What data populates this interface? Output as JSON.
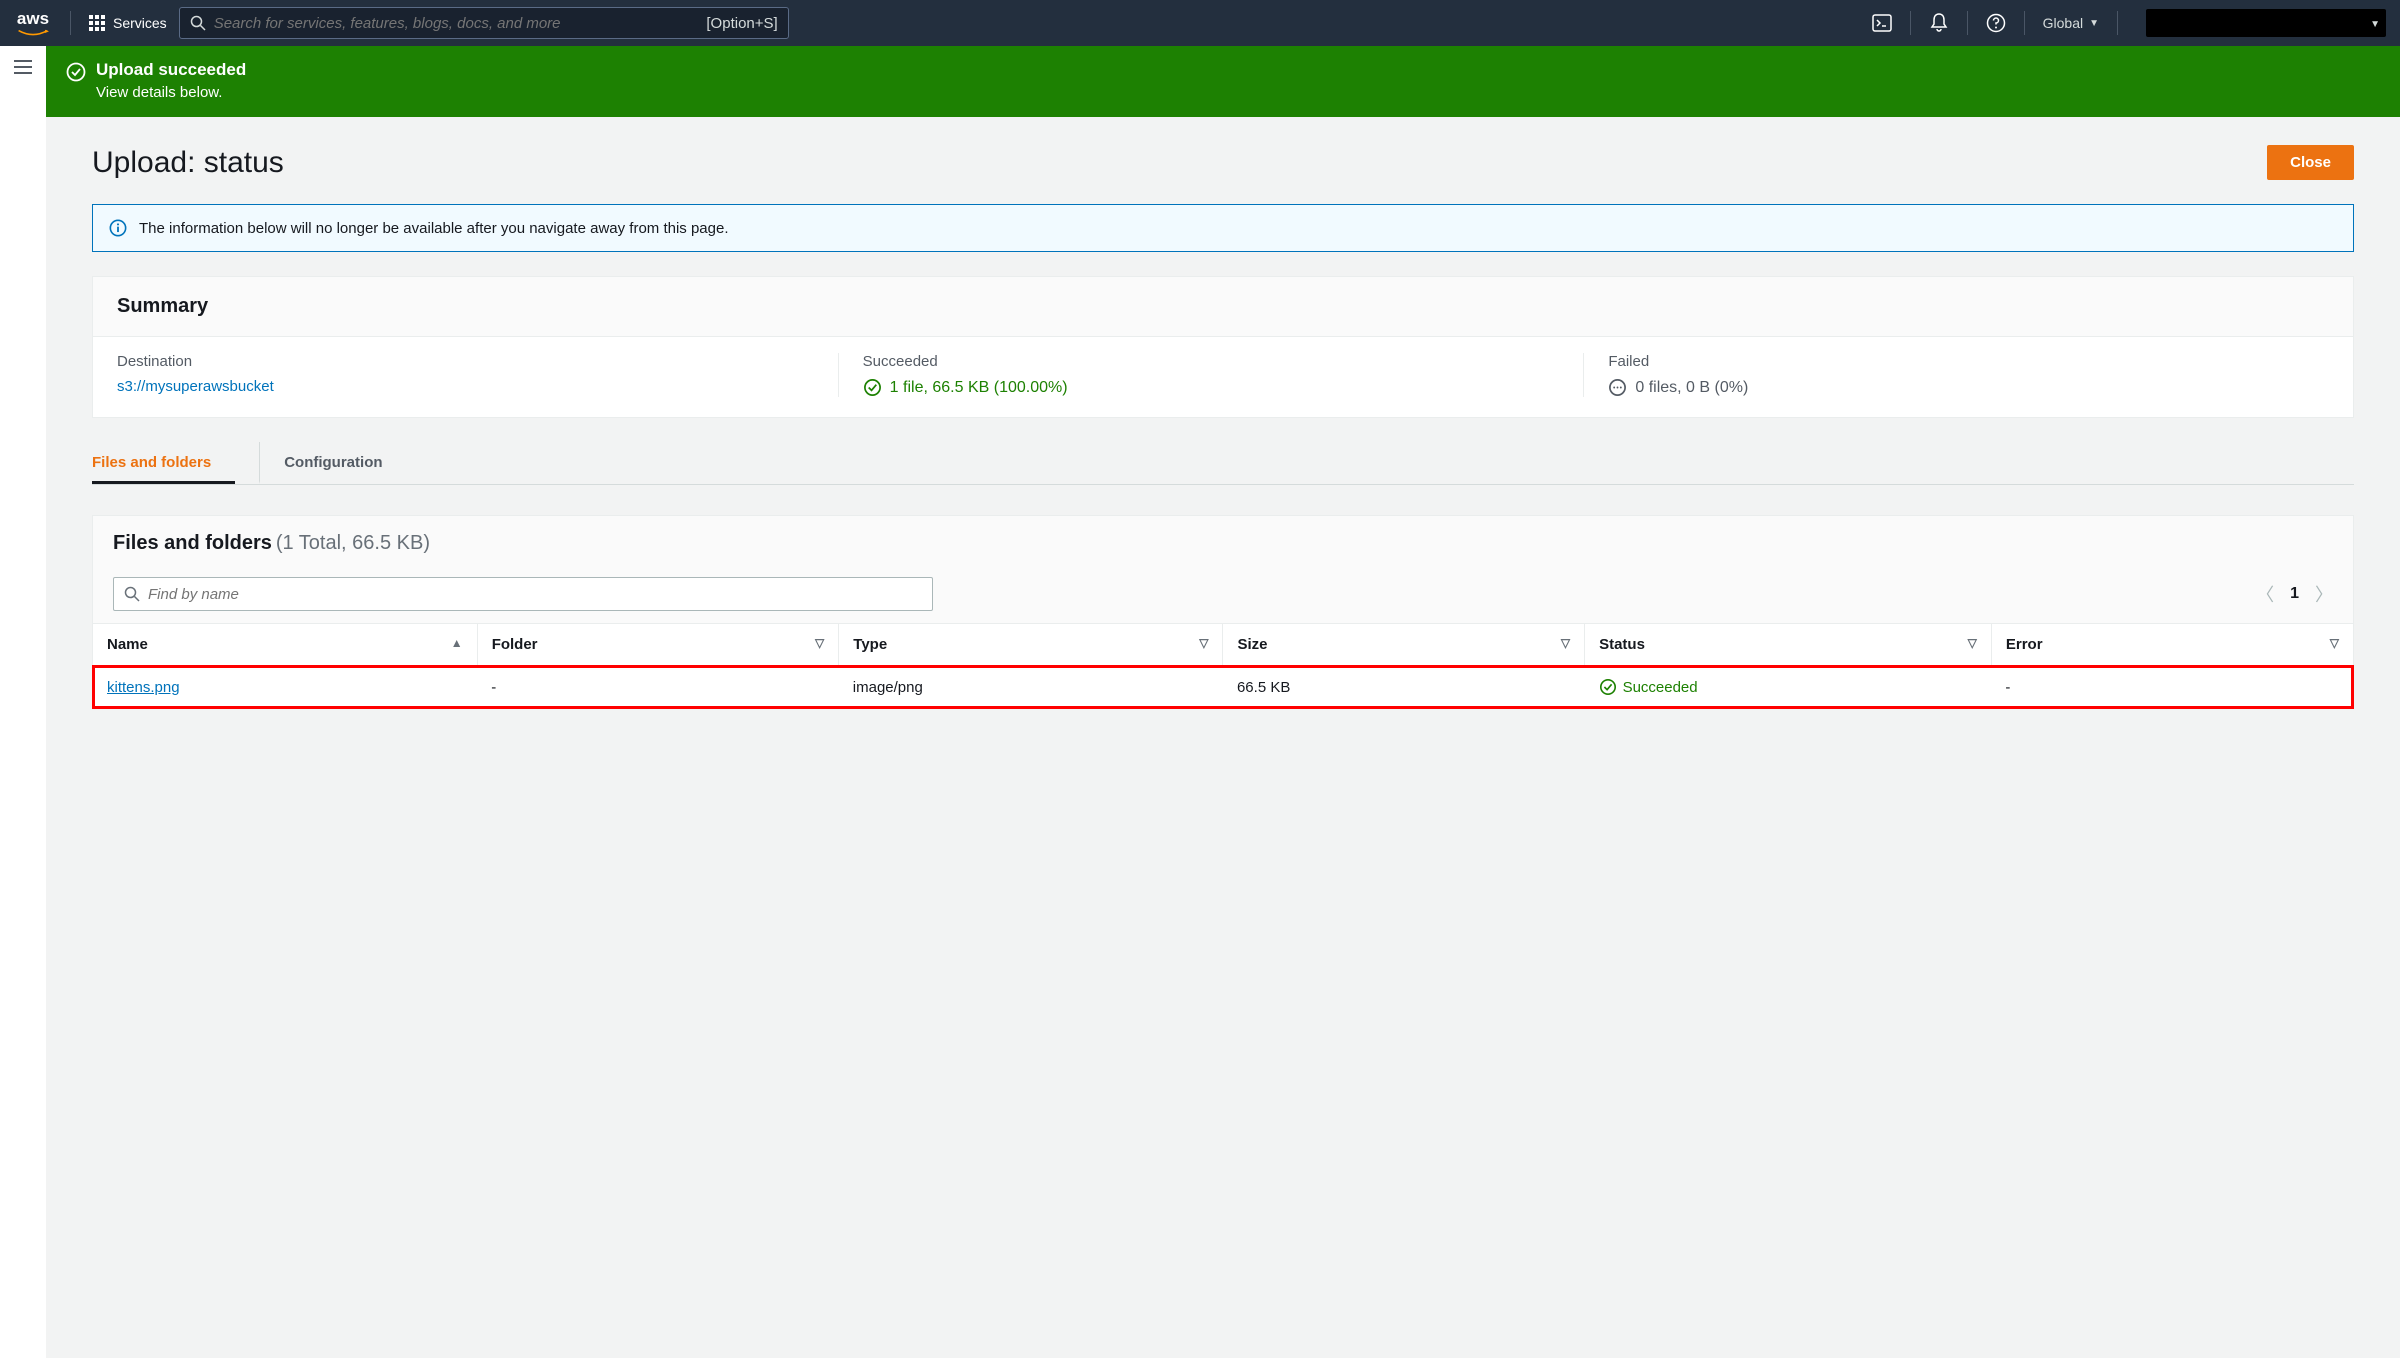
{
  "nav": {
    "services_label": "Services",
    "search_placeholder": "Search for services, features, blogs, docs, and more",
    "search_shortcut": "[Option+S]",
    "region": "Global"
  },
  "banner": {
    "title": "Upload succeeded",
    "subtitle": "View details below."
  },
  "page": {
    "title": "Upload: status",
    "close_label": "Close"
  },
  "alert": {
    "message": "The information below will no longer be available after you navigate away from this page."
  },
  "summary": {
    "heading": "Summary",
    "destination_label": "Destination",
    "destination_value": "s3://mysuperawsbucket",
    "succeeded_label": "Succeeded",
    "succeeded_value": "1 file, 66.5 KB (100.00%)",
    "failed_label": "Failed",
    "failed_value": "0 files, 0 B (0%)"
  },
  "tabs": {
    "files": "Files and folders",
    "config": "Configuration"
  },
  "files_section": {
    "title": "Files and folders",
    "count": "(1 Total, 66.5 KB)",
    "find_placeholder": "Find by name",
    "page_number": "1",
    "columns": {
      "name": "Name",
      "folder": "Folder",
      "type": "Type",
      "size": "Size",
      "status": "Status",
      "error": "Error"
    },
    "rows": [
      {
        "name": "kittens.png",
        "folder": "-",
        "type": "image/png",
        "size": "66.5 KB",
        "status": "Succeeded",
        "error": "-"
      }
    ]
  }
}
